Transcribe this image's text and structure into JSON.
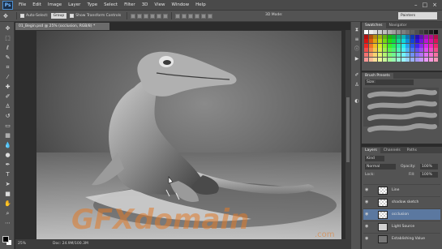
{
  "app": {
    "logo": "Ps"
  },
  "menu": [
    "File",
    "Edit",
    "Image",
    "Layer",
    "Type",
    "Select",
    "Filter",
    "3D",
    "View",
    "Window",
    "Help"
  ],
  "window_controls": [
    "–",
    "□",
    "×"
  ],
  "options_bar": {
    "auto_select_label": "Auto-Select:",
    "auto_select_value": "Group",
    "transform_label": "Show Transform Controls",
    "mode_3d": "3D Mode:",
    "workspace": "Painters"
  },
  "document": {
    "tab_title": "01_Begin.psd @ 25% (occlusion, RGB/8) *",
    "zoom": "25%",
    "doc_size": "Doc: 24.9M/100.3M"
  },
  "panels": {
    "swatches_tabs": [
      "Swatches",
      "Navigator"
    ],
    "brush_tab": "Brush Presets",
    "brush_select": "Size:",
    "layers_tabs": [
      "Layers",
      "Channels",
      "Paths"
    ],
    "kind_label": "Kind",
    "blend_mode": "Normal",
    "opacity_label": "Opacity:",
    "opacity_value": "100%",
    "lock_label": "Lock:",
    "fill_label": "Fill:",
    "fill_value": "100%"
  },
  "layers": [
    {
      "name": "Line",
      "selected": false
    },
    {
      "name": "shadow sketch",
      "selected": false
    },
    {
      "name": "occlusion",
      "selected": true
    },
    {
      "name": "Light Source",
      "selected": false
    },
    {
      "name": "Establishing Value",
      "selected": false
    }
  ],
  "watermark": "GFXdomain",
  "watermark_sub": ".com",
  "colors": {
    "accent": "#5b78a0",
    "ps_blue": "#73b8ff",
    "watermark": "#e07b2a"
  },
  "toolbar_icons": [
    "move-icon",
    "marquee-icon",
    "lasso-icon",
    "quick-select-icon",
    "crop-icon",
    "eyedropper-icon",
    "healing-icon",
    "brush-icon",
    "clone-stamp-icon",
    "history-brush-icon",
    "eraser-icon",
    "gradient-icon",
    "blur-icon",
    "dodge-icon",
    "pen-icon",
    "type-icon",
    "path-select-icon",
    "shape-icon",
    "hand-icon",
    "zoom-icon"
  ]
}
